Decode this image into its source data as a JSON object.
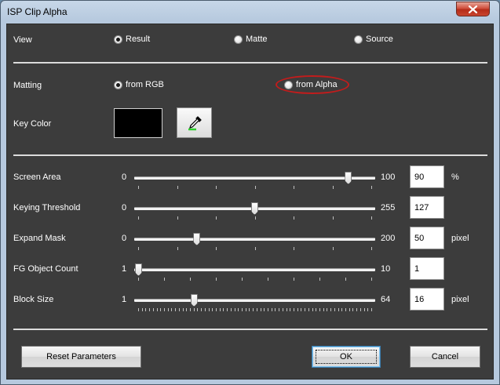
{
  "window": {
    "title": "ISP Clip Alpha",
    "close_icon": "close-icon"
  },
  "view": {
    "label": "View",
    "options": [
      "Result",
      "Matte",
      "Source"
    ],
    "selected": "Result"
  },
  "matting": {
    "label": "Matting",
    "options": [
      "from RGB",
      "from Alpha"
    ],
    "selected": "from RGB",
    "highlighted": "from Alpha",
    "highlight_color": "#c21c1c"
  },
  "key_color": {
    "label": "Key Color",
    "swatch_color": "#000000",
    "picker_icon": "eyedropper-icon"
  },
  "sliders": [
    {
      "label": "Screen Area",
      "min": "0",
      "max": "100",
      "value": "90",
      "unit": "%",
      "fraction": 0.9,
      "ticks": 7
    },
    {
      "label": "Keying Threshold",
      "min": "0",
      "max": "255",
      "value": "127",
      "unit": "",
      "fraction": 0.498,
      "ticks": 7
    },
    {
      "label": "Expand Mask",
      "min": "0",
      "max": "200",
      "value": "50",
      "unit": "pixel",
      "fraction": 0.25,
      "ticks": 7
    },
    {
      "label": "FG Object Count",
      "min": "1",
      "max": "10",
      "value": "1",
      "unit": "",
      "fraction": 0.0,
      "ticks": 10
    },
    {
      "label": "Block Size",
      "min": "1",
      "max": "64",
      "value": "16",
      "unit": "pixel",
      "fraction": 0.238,
      "ticks": 64
    }
  ],
  "buttons": {
    "reset": "Reset Parameters",
    "ok": "OK",
    "cancel": "Cancel"
  }
}
